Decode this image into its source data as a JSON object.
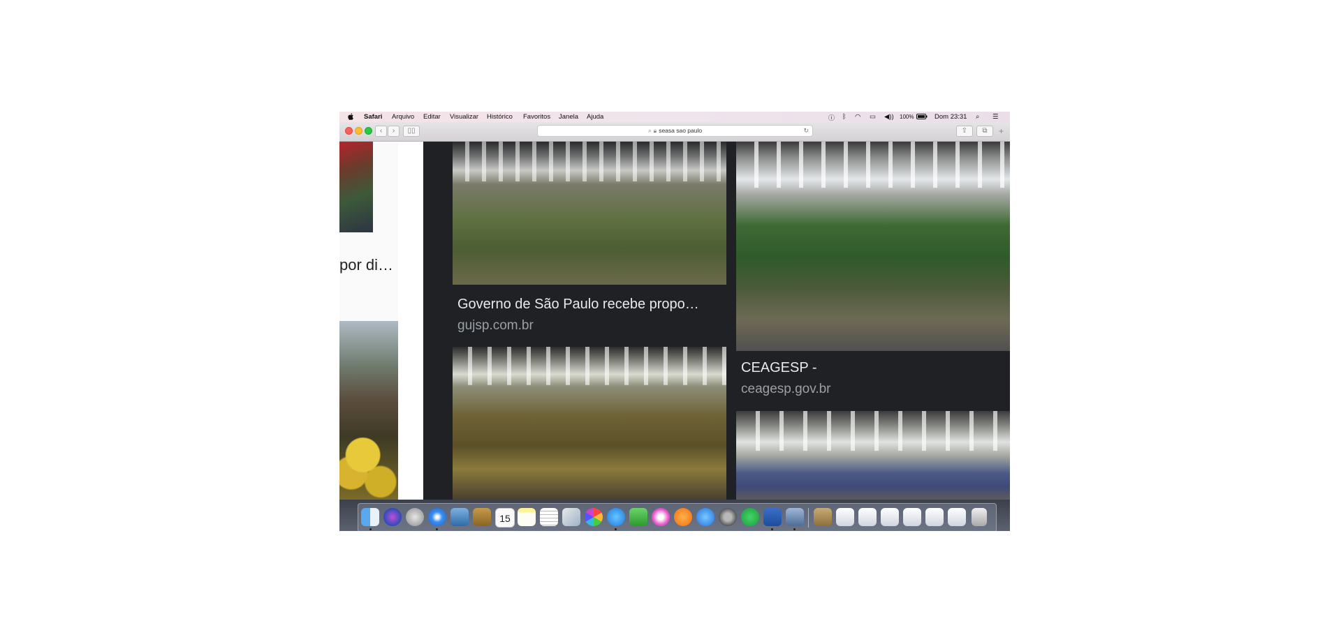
{
  "menubar": {
    "app_name": "Safari",
    "menus": [
      "Arquivo",
      "Editar",
      "Visualizar",
      "Histórico",
      "Favoritos",
      "Janela",
      "Ajuda"
    ],
    "battery": "100%",
    "clock": "Dom 23:31"
  },
  "toolbar": {
    "address": "seasa sao paulo"
  },
  "left_result": {
    "title_fragment": "por di…"
  },
  "results": [
    {
      "title": "Governo de São Paulo recebe propo…",
      "source": "gujsp.com.br"
    },
    {
      "title": "CEAGESP -",
      "source": "ceagesp.gov.br"
    }
  ],
  "dock": {
    "calendar_day": "15",
    "icons": [
      "finder-icon",
      "siri-icon",
      "launchpad-icon",
      "safari-icon",
      "preview-icon",
      "notefile-icon",
      "calendar-icon",
      "notes-icon",
      "textedit-icon",
      "preview2-icon",
      "photos-icon",
      "messages-icon",
      "facetime-icon",
      "itunes-icon",
      "ibooks-icon",
      "appstore-icon",
      "system-preferences-icon",
      "whatsapp-icon",
      "word-icon",
      "photo-browser-icon",
      "folder-downloads-icon",
      "stack-1-icon",
      "stack-2-icon",
      "stack-3-icon",
      "stack-4-icon",
      "stack-5-icon",
      "stack-6-icon",
      "trash-icon"
    ]
  }
}
